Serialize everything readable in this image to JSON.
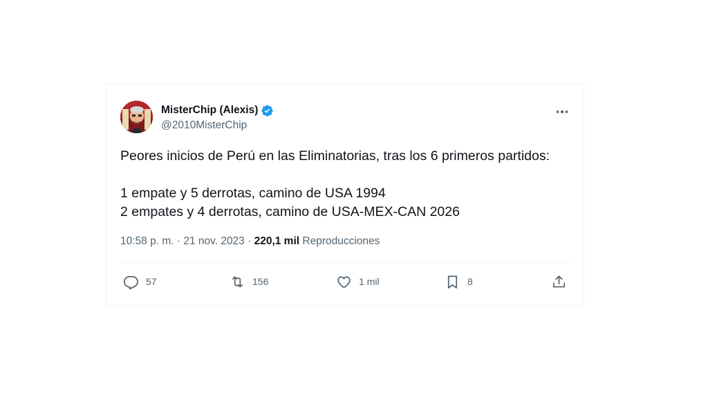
{
  "author": {
    "display_name": "MisterChip (Alexis)",
    "handle": "@2010MisterChip",
    "verified": true
  },
  "tweet": {
    "lines": [
      "Peores inicios de Perú en las Eliminatorias, tras los 6 primeros partidos:",
      "1 empate y 5 derrotas, camino de USA 1994",
      "2 empates y 4 derrotas, camino de USA-MEX-CAN 2026"
    ]
  },
  "meta": {
    "timestamp": "10:58 p. m. · 21 nov. 2023 · ",
    "views_count": "220,1 mil",
    "views_label": " Reproducciones"
  },
  "actions": {
    "replies": "57",
    "retweets": "156",
    "likes": "1 mil",
    "bookmarks": "8"
  },
  "colors": {
    "text": "#0f1419",
    "secondary": "#536471",
    "verified": "#1d9bf0",
    "border": "#eff3f4"
  },
  "icons": {
    "more": "more-horizontal-icon",
    "reply": "reply-icon",
    "retweet": "retweet-icon",
    "like": "heart-icon",
    "bookmark": "bookmark-icon",
    "share": "share-icon",
    "verified": "verified-badge-icon"
  }
}
